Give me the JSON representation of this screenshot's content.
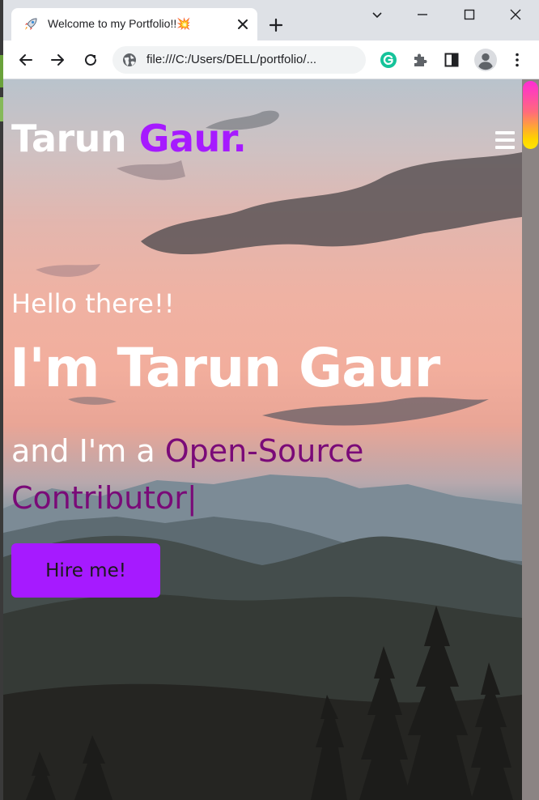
{
  "browser": {
    "tab": {
      "title": "Welcome to my Portfolio!!💥",
      "favicon": "rocket-icon"
    },
    "address_bar": {
      "url": "file:///C:/Users/DELL/portfolio/..."
    },
    "extensions": [
      "grammarly-icon",
      "puzzle-extensions-icon",
      "side-panel-icon",
      "profile-avatar-icon",
      "kebab-menu-icon"
    ],
    "window_controls": [
      "tab-search-icon",
      "minimize-icon",
      "maximize-icon",
      "close-window-icon"
    ]
  },
  "page": {
    "logo": {
      "first": "Tarun ",
      "accent": "Gaur."
    },
    "hero": {
      "greeting": "Hello there!!",
      "name": "I'm Tarun Gaur",
      "role_prefix": "and I'm a ",
      "role_typed": "Open-Source Contributor|",
      "cta": "Hire me!"
    },
    "menu_icon": "hamburger-menu-icon"
  },
  "colors": {
    "accent": "#a61aff",
    "typed_text": "#7a0a78",
    "scroll_thumb_top": "#ff2bd5",
    "scroll_thumb_bottom": "#ffe600"
  }
}
